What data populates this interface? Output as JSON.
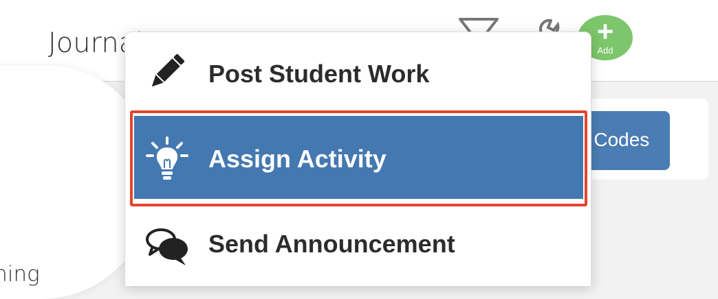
{
  "header": {
    "title": "Journal",
    "add_button": {
      "icon": "plus-icon",
      "label": "Add",
      "color": "#7dc66b"
    },
    "filter_icon": "filter-icon",
    "tools_icon": "wrench-icon"
  },
  "background": {
    "codes_button_label": "g Codes",
    "left_panel_text": "arning"
  },
  "menu": {
    "items": [
      {
        "label": "Post Student Work",
        "icon": "pencil-icon",
        "selected": false
      },
      {
        "label": "Assign Activity",
        "icon": "lightbulb-icon",
        "selected": true
      },
      {
        "label": "Send Announcement",
        "icon": "speech-bubbles-icon",
        "selected": false
      }
    ],
    "highlight_color": "#4478b0",
    "outline_color": "#e2452e"
  }
}
